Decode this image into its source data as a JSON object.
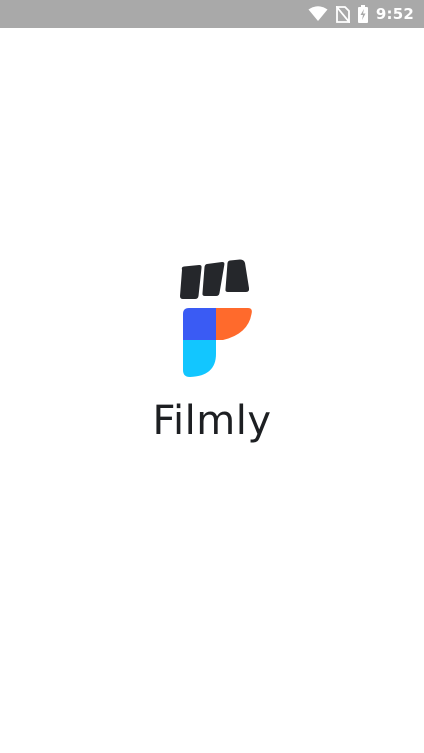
{
  "status_bar": {
    "time": "9:52",
    "icons": [
      "wifi-icon",
      "no-sim-icon",
      "battery-charging-icon"
    ]
  },
  "splash": {
    "app_name": "Filmly",
    "logo": "filmly-logo"
  },
  "colors": {
    "status_bar_bg": "#a9a9a9",
    "background": "#ffffff",
    "text": "#1d1f22",
    "logo_dark": "#25272b",
    "logo_blue": "#3a5bf4",
    "logo_orange": "#ff6a2c",
    "logo_cyan": "#12c6ff"
  }
}
